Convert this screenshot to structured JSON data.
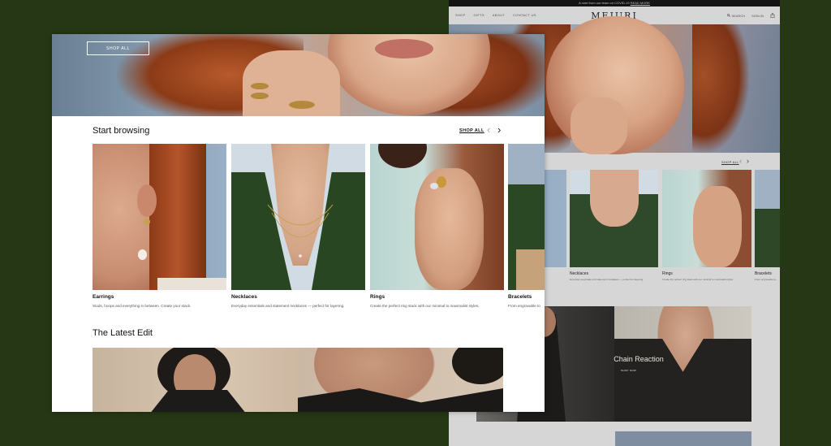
{
  "background_page": {
    "announcement": "A note from our team on COVID-19",
    "announcement_link": "READ MORE",
    "nav_links": [
      "SHOP",
      "GIFTS",
      "ABOUT",
      "CONTACT US"
    ],
    "logo": "MEJURI",
    "search": "SEARCH",
    "signin": "SIGN IN",
    "cart_icon": "bag-icon",
    "shop_all": "SHOP ALL",
    "categories": [
      {
        "label": "Necklaces",
        "desc": "Everyday essentials and statement necklaces — perfect for layering."
      },
      {
        "label": "Rings",
        "desc": "Create the perfect ring stack with our minimal to maximalist styles."
      },
      {
        "label": "Bracelets",
        "desc": "From engravable to..."
      }
    ],
    "editorial_title": "Chain Reaction",
    "editorial_cta": "SHOP NOW"
  },
  "foreground_page": {
    "hero_button": "SHOP ALL",
    "section_title": "Start browsing",
    "shop_all": "SHOP ALL",
    "prev_icon": "chevron-left-icon",
    "next_icon": "chevron-right-icon",
    "categories": [
      {
        "label": "Earrings",
        "desc": "Studs, hoops and everything in between. Create your stack."
      },
      {
        "label": "Necklaces",
        "desc": "Everyday essentials and statement necklaces — perfect for layering."
      },
      {
        "label": "Rings",
        "desc": "Create the perfect ring stack with our minimal to maximalist styles."
      },
      {
        "label": "Bracelets",
        "desc": "From engravable to"
      }
    ],
    "latest_title": "The Latest Edit"
  },
  "colors": {
    "backdrop": "#263715",
    "page_bg": "#ffffff",
    "text": "#111111"
  }
}
